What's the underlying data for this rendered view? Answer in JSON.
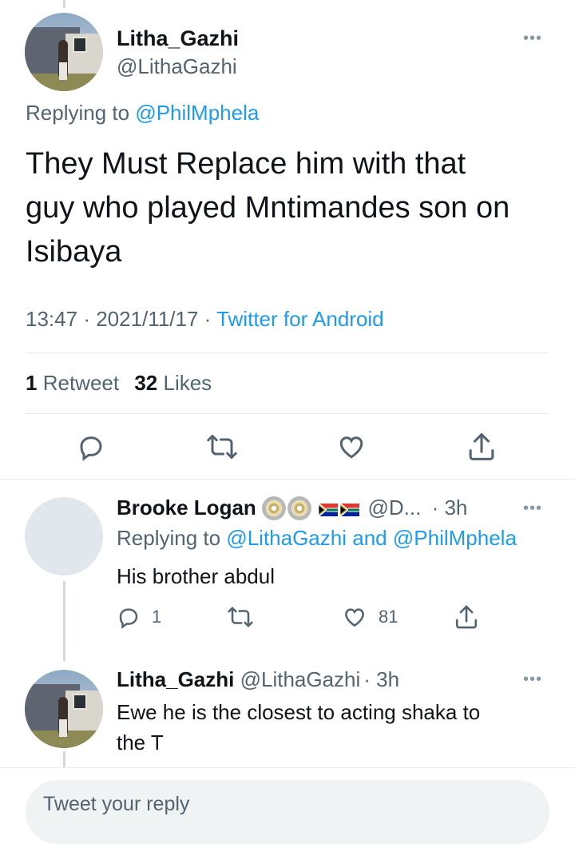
{
  "main_tweet": {
    "display_name": "Litha_Gazhi",
    "handle": "@LithaGazhi",
    "replying_label": "Replying to",
    "replying_to": "@PhilMphela",
    "text_line1": "They Must Replace him with that",
    "text_line2": "guy who played Mntimandes son on",
    "text_line3": "Isibaya",
    "time": "13:47",
    "date": "2021/11/17",
    "sep": "·",
    "source": "Twitter for Android",
    "retweets_count": "1",
    "retweets_label": "Retweet",
    "likes_count": "32",
    "likes_label": "Likes"
  },
  "reply1": {
    "display_name": "Brooke Logan",
    "handle": "@D...",
    "time": "· 3h",
    "replying_label": "Replying to",
    "replying_to_1": "@LithaGazhi",
    "replying_and": "and",
    "replying_to_2": "@PhilMphela",
    "text": "His brother abdul",
    "reply_count": "1",
    "like_count": "81"
  },
  "reply2": {
    "display_name": "Litha_Gazhi",
    "handle": "@LithaGazhi",
    "time": "· 3h",
    "text_line1": "Ewe he is the closest to acting shaka to",
    "text_line2": "the T"
  },
  "composer": {
    "placeholder": "Tweet your reply"
  },
  "colors": {
    "link": "#1d9bf0",
    "muted": "#536471",
    "icon": "#536471",
    "divider": "#e6ecf0"
  },
  "icons": [
    "more-icon",
    "reply-icon",
    "retweet-icon",
    "like-icon",
    "share-icon"
  ]
}
